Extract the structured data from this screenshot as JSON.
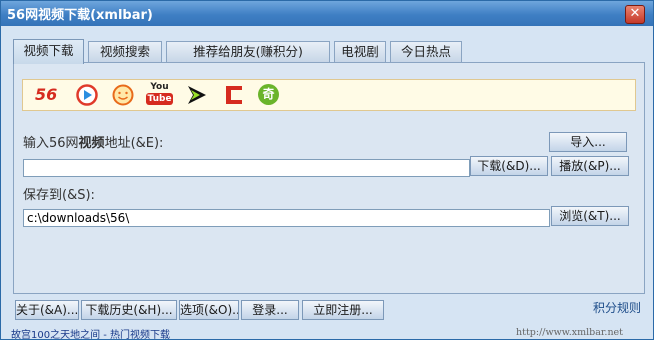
{
  "window": {
    "title": "56网视频下载(xmlbar)"
  },
  "tabs": [
    {
      "label": "视频下载"
    },
    {
      "label": "视频搜索"
    },
    {
      "label": "推荐给朋友(赚积分)"
    },
    {
      "label": "电视剧"
    },
    {
      "label": "今日热点"
    }
  ],
  "sites": [
    {
      "icon": "site-56-logo-icon",
      "text": "56"
    },
    {
      "icon": "site-play-logo-icon"
    },
    {
      "icon": "site-smiley-logo-icon"
    },
    {
      "icon": "site-youtube-logo-icon",
      "text_top": "You",
      "text_bottom": "Tube"
    },
    {
      "icon": "site-arrow-logo-icon"
    },
    {
      "icon": "site-red-logo-icon"
    },
    {
      "icon": "site-qi-logo-icon",
      "text": "奇"
    }
  ],
  "colors": {
    "title_bar": "#3f7fc4",
    "accent_red": "#d62b1f",
    "link_blue": "#1a3a8a"
  },
  "form": {
    "url_label_prefix": "输入56网",
    "url_label_bold": "视频",
    "url_label_suffix": "地址(&E):",
    "url_value": "",
    "import_label": "导入...",
    "download_label": "下载(&D)...",
    "play_label": "播放(&P)...",
    "save_label": "保存到(&S):",
    "save_path": "c:\\downloads\\56\\",
    "browse_label": "浏览(&T)..."
  },
  "bottom": {
    "about": "关于(&A)...",
    "history": "下载历史(&H)...",
    "options": "选项(&O)...",
    "login": "登录...",
    "register": "立即注册...",
    "points_rule": "积分规则"
  },
  "footer": {
    "link_text": "故宫100之天地之间 - 热门视频下载",
    "url": "http://www.xmlbar.net"
  }
}
